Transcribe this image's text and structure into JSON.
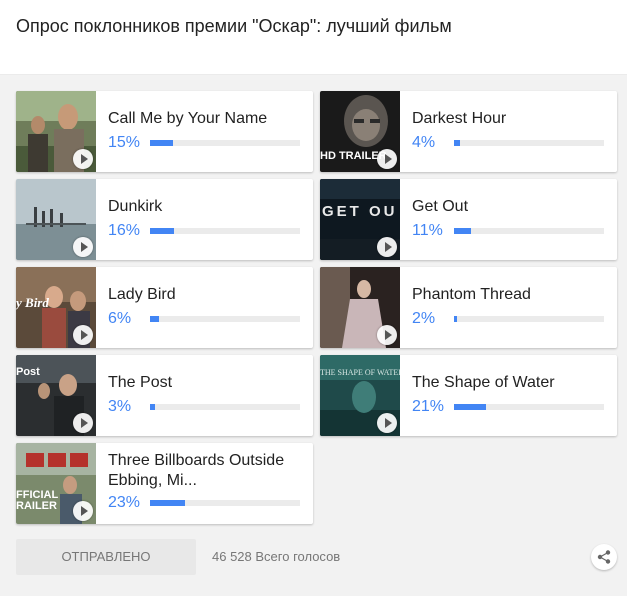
{
  "poll": {
    "title": "Опрос поклонников премии \"Оскар\": лучший фильм",
    "accent_color": "#4285f4",
    "submit_label": "ОТПРАВЛЕНО",
    "total_votes": "46 528 Всего голосов",
    "share_icon": "share-icon",
    "play_icon": "play-icon",
    "options": [
      {
        "name": "Call Me by Your Name",
        "percent": "15%",
        "value": 0.15,
        "thumb_text": ""
      },
      {
        "name": "Darkest Hour",
        "percent": "4%",
        "value": 0.04,
        "thumb_text": "HD TRAILER"
      },
      {
        "name": "Dunkirk",
        "percent": "16%",
        "value": 0.16,
        "thumb_text": ""
      },
      {
        "name": "Get Out",
        "percent": "11%",
        "value": 0.11,
        "thumb_text": "GET OU"
      },
      {
        "name": "Lady Bird",
        "percent": "6%",
        "value": 0.06,
        "thumb_text": "y Bird"
      },
      {
        "name": "Phantom Thread",
        "percent": "2%",
        "value": 0.02,
        "thumb_text": ""
      },
      {
        "name": "The Post",
        "percent": "3%",
        "value": 0.03,
        "thumb_text": "Post"
      },
      {
        "name": "The Shape of Water",
        "percent": "21%",
        "value": 0.21,
        "thumb_text": "THE SHAPE OF WATER"
      },
      {
        "name": "Three Billboards Outside Ebbing, Mi...",
        "percent": "23%",
        "value": 0.23,
        "thumb_text": "FFICIAL RAILER"
      }
    ]
  }
}
